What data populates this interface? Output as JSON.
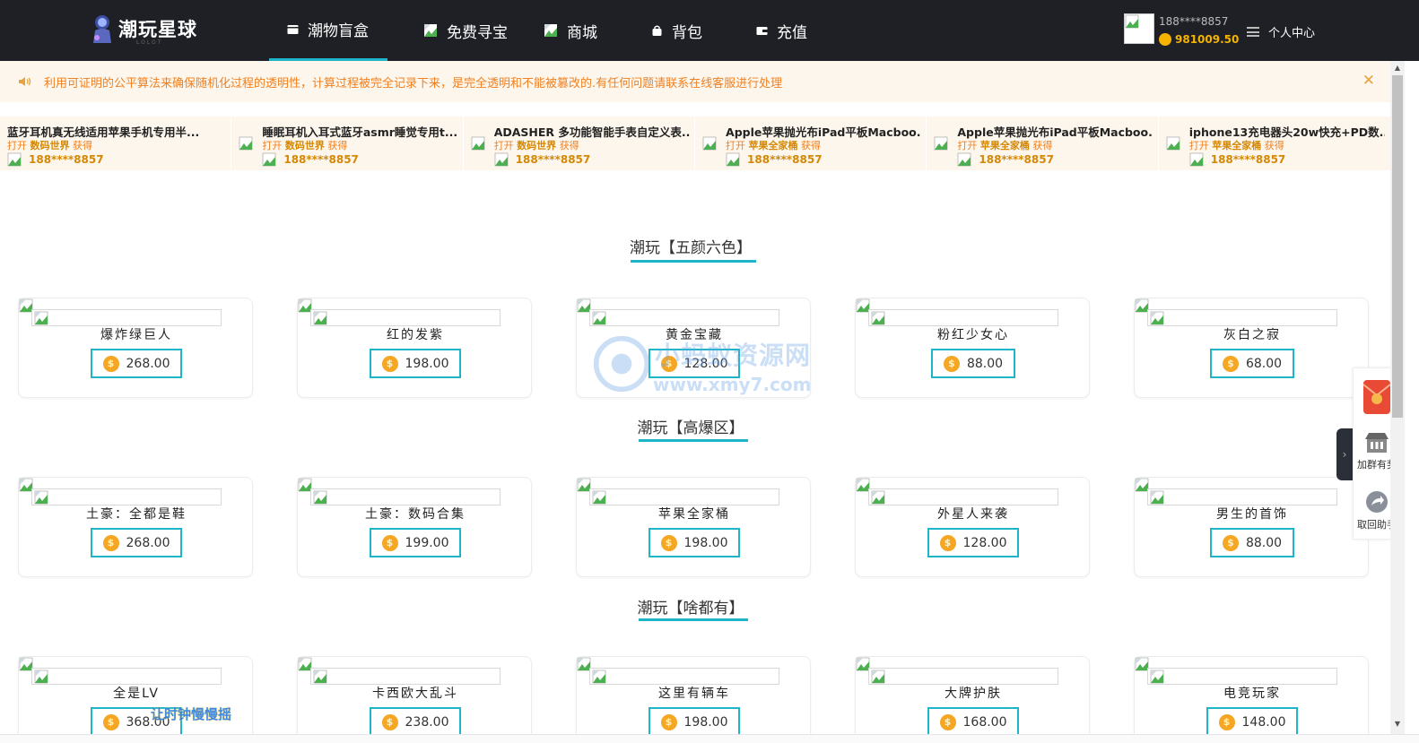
{
  "brand": {
    "name": "潮玩星球",
    "sub": "LOLOT"
  },
  "nav": [
    {
      "label": "潮物盲盒",
      "active": true,
      "icon": "box-icon"
    },
    {
      "label": "免费寻宝",
      "active": false,
      "icon": "broken-image-icon"
    },
    {
      "label": "商城",
      "active": false,
      "icon": "broken-image-icon"
    },
    {
      "label": "背包",
      "active": false,
      "icon": "bag-icon"
    },
    {
      "label": "充值",
      "active": false,
      "icon": "wallet-icon"
    }
  ],
  "account": {
    "user": "188****8857",
    "balance": "981009.50",
    "personal_label": "个人中心"
  },
  "notice": {
    "text": "利用可证明的公平算法来确保随机化过程的透明性，计算过程被完全记录下来，是完全透明和不能被篡改的.有任何问题请联系在线客服进行处理"
  },
  "ticker": [
    {
      "title": "蓝牙耳机真无线适用苹果手机专用半...",
      "pre": "打开",
      "box": "数码世界",
      "post": "获得",
      "user": "188****8857"
    },
    {
      "title": "睡眠耳机入耳式蓝牙asmr睡觉专用t...",
      "pre": "打开",
      "box": "数码世界",
      "post": "获得",
      "user": "188****8857"
    },
    {
      "title": "ADASHER 多功能智能手表自定义表...",
      "pre": "打开",
      "box": "数码世界",
      "post": "获得",
      "user": "188****8857"
    },
    {
      "title": "Apple苹果抛光布iPad平板Macboo...",
      "pre": "打开",
      "box": "苹果全家桶",
      "post": "获得",
      "user": "188****8857"
    },
    {
      "title": "Apple苹果抛光布iPad平板Macboo...",
      "pre": "打开",
      "box": "苹果全家桶",
      "post": "获得",
      "user": "188****8857"
    },
    {
      "title": "iphone13充电器头20w快充+PD数...",
      "pre": "打开",
      "box": "苹果全家桶",
      "post": "获得",
      "user": "188****8857"
    }
  ],
  "sections": [
    {
      "title": "潮玩【五颜六色】",
      "items": [
        {
          "name": "爆炸绿巨人",
          "price": "268.00"
        },
        {
          "name": "红的发紫",
          "price": "198.00"
        },
        {
          "name": "黄金宝藏",
          "price": "128.00"
        },
        {
          "name": "粉红少女心",
          "price": "88.00"
        },
        {
          "name": "灰白之寂",
          "price": "68.00"
        }
      ]
    },
    {
      "title": "潮玩【高爆区】",
      "items": [
        {
          "name": "土豪：全都是鞋",
          "price": "268.00"
        },
        {
          "name": "土豪：数码合集",
          "price": "199.00"
        },
        {
          "name": "苹果全家桶",
          "price": "198.00"
        },
        {
          "name": "外星人来袭",
          "price": "128.00"
        },
        {
          "name": "男生的首饰",
          "price": "88.00"
        }
      ]
    },
    {
      "title": "潮玩【啥都有】",
      "items": [
        {
          "name": "全是LV",
          "price": "368.00"
        },
        {
          "name": "卡西欧大乱斗",
          "price": "238.00"
        },
        {
          "name": "这里有辆车",
          "price": "198.00"
        },
        {
          "name": "大牌护肤",
          "price": "168.00"
        },
        {
          "name": "电竞玩家",
          "price": "148.00"
        }
      ]
    }
  ],
  "coin_symbol": "$",
  "watermark": {
    "line1": "小蚂蚁资源网",
    "line2": "www.xmy7.com",
    "bottom": "让时钟慢慢摇"
  },
  "float": {
    "group": "加群有奖",
    "recycle": "取回助手",
    "tab": "›"
  },
  "colors": {
    "header": "#1e2026",
    "accent": "#1fb5c9",
    "notice_bg": "#fdf6ec",
    "notice_text": "#f08020",
    "coin": "#f5a623"
  }
}
